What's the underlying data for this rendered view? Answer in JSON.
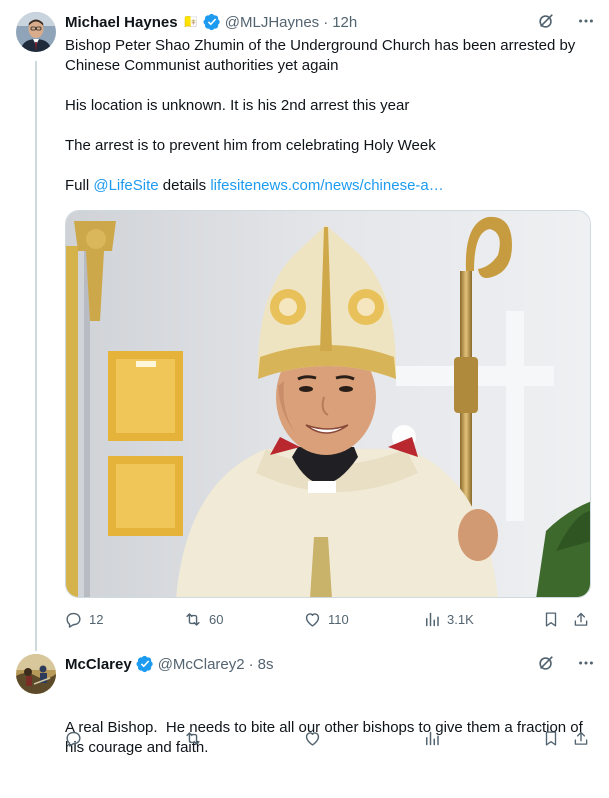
{
  "tweet1": {
    "author_name": "Michael Haynes",
    "author_emoji": "🇻🇦",
    "handle": "@MLJHaynes",
    "separator": "·",
    "time": "12h",
    "lines": [
      "Bishop Peter Shao Zhumin of the Underground Church has been arrested by Chinese Communist authorities yet again",
      "His location is unknown. It is his 2nd arrest this year",
      "The arrest is to prevent him from celebrating Holy Week"
    ],
    "full_prefix": "Full",
    "mention": "@LifeSite",
    "full_middle": "details",
    "url": "lifesitenews.com/news/chinese-a…",
    "stats": {
      "replies": "12",
      "reposts": "60",
      "likes": "110",
      "views": "3.1K"
    }
  },
  "tweet2": {
    "author_name": "McClarey",
    "handle": "@McClarey2",
    "separator": "·",
    "time": "8s",
    "text": "A real Bishop.  He needs to bite all our other bishops to give them a fraction of his courage and faith."
  },
  "icons": {
    "grok": "grok-icon",
    "more": "more-icon",
    "reply": "reply-icon",
    "repost": "repost-icon",
    "like": "like-icon",
    "views": "views-icon",
    "bookmark": "bookmark-icon",
    "share": "share-icon",
    "verified": "verified-badge-icon"
  },
  "colors": {
    "link": "#1d9bf0",
    "muted": "#536471",
    "verified": "#1d9bf0"
  }
}
